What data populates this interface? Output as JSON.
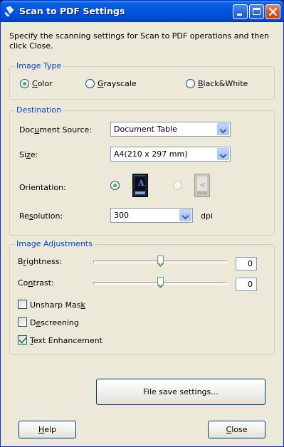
{
  "window": {
    "title": "Scan to PDF Settings"
  },
  "intro": "Specify the scanning settings for Scan to PDF operations and then click Close.",
  "image_type": {
    "label": "Image Type",
    "options": [
      {
        "pre": "",
        "mn": "C",
        "post": "olor",
        "selected": true
      },
      {
        "pre": "",
        "mn": "G",
        "post": "rayscale",
        "selected": false
      },
      {
        "pre": "",
        "mn": "B",
        "post": "lack&White",
        "selected": false
      }
    ]
  },
  "destination": {
    "label": "Destination",
    "document_source": {
      "pre": "Doc",
      "mn": "u",
      "post": "ment Source:",
      "value": "Document Table"
    },
    "size": {
      "pre": "Si",
      "mn": "z",
      "post": "e:",
      "value": "A4(210 x 297 mm)"
    },
    "orientation": {
      "label": "Orientation:",
      "selected": "portrait"
    },
    "resolution": {
      "pre": "Re",
      "mn": "s",
      "post": "olution:",
      "value": "300",
      "unit": "dpi"
    }
  },
  "image_adjustments": {
    "label": "Image Adjustments",
    "brightness": {
      "pre": "B",
      "mn": "r",
      "post": "ightness:",
      "value": "0",
      "level": 0.5
    },
    "contrast": {
      "pre": "Co",
      "mn": "n",
      "post": "trast:",
      "value": "0",
      "level": 0.5
    },
    "unsharp_mask": {
      "pre": "Unsharp Mas",
      "mn": "k",
      "post": "",
      "checked": false
    },
    "descreening": {
      "pre": "D",
      "mn": "e",
      "post": "screening",
      "checked": false
    },
    "text_enhancement": {
      "pre": "",
      "mn": "T",
      "post": "ext Enhancement",
      "checked": true
    }
  },
  "buttons": {
    "file_save": "File save settings...",
    "help": {
      "pre": "",
      "mn": "H",
      "post": "elp"
    },
    "close": {
      "pre": "",
      "mn": "C",
      "post": "lose"
    }
  }
}
